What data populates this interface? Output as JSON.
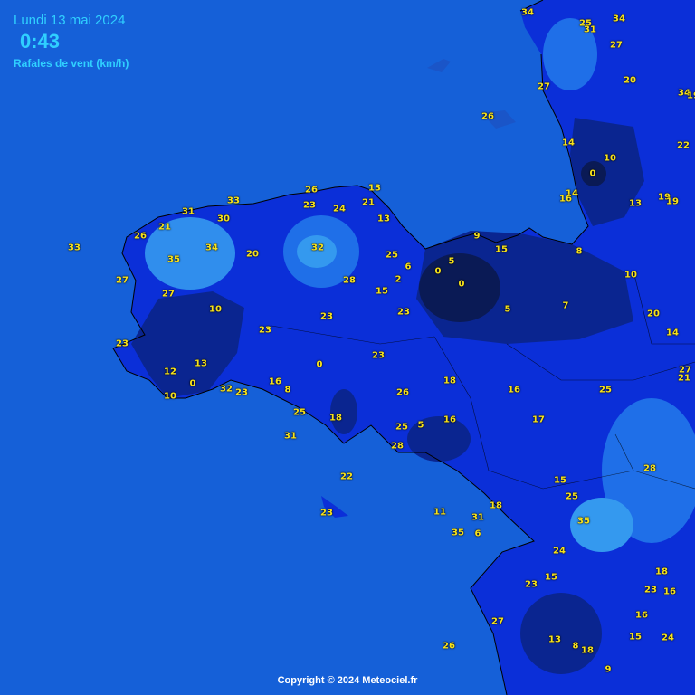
{
  "header": {
    "date": "Lundi 13 mai 2024",
    "time": "0:43",
    "parameter": "Rafales de vent (km/h)"
  },
  "footer": {
    "copyright": "Copyright © 2024 Meteociel.fr"
  },
  "colors": {
    "sea": "#1560d8",
    "land_mid": "#0b2fd8",
    "light": "#3499ef",
    "dark": "#0a2590",
    "darkest": "#0a1a55",
    "label": "#f7e21b"
  },
  "stations": [
    "34",
    "25",
    "31",
    "34",
    "27",
    "20",
    "34",
    "19",
    "27",
    "26",
    "22",
    "14",
    "10",
    "0",
    "14",
    "16",
    "13",
    "19",
    "19",
    "26",
    "13",
    "33",
    "31",
    "23",
    "24",
    "21",
    "13",
    "30",
    "21",
    "26",
    "32",
    "34",
    "33",
    "25",
    "6",
    "9",
    "15",
    "35",
    "20",
    "8",
    "0",
    "5",
    "27",
    "27",
    "10",
    "2",
    "28",
    "0",
    "10",
    "15",
    "23",
    "23",
    "5",
    "7",
    "20",
    "23",
    "14",
    "23",
    "23",
    "13",
    "0",
    "27",
    "21",
    "12",
    "0",
    "10",
    "16",
    "32",
    "23",
    "8",
    "26",
    "18",
    "16",
    "25",
    "25",
    "18",
    "5",
    "16",
    "17",
    "31",
    "25",
    "28",
    "22",
    "28",
    "15",
    "25",
    "18",
    "11",
    "31",
    "35",
    "6",
    "35",
    "24",
    "15",
    "18",
    "23",
    "23",
    "16",
    "23",
    "16",
    "27",
    "15",
    "24",
    "13",
    "8",
    "18",
    "26",
    "9"
  ]
}
